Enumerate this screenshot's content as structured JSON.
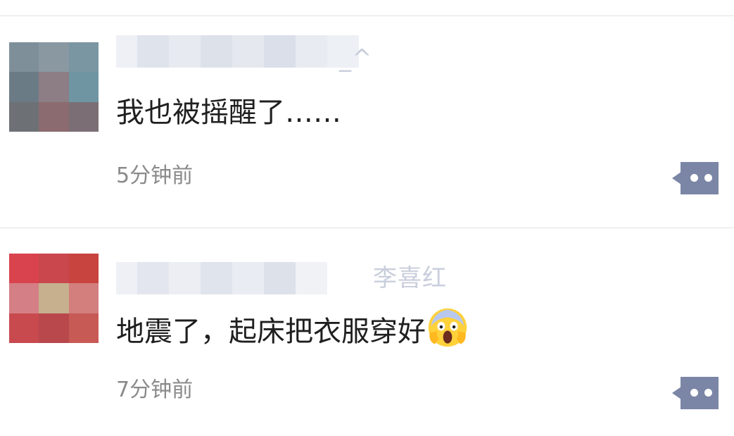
{
  "comments": [
    {
      "author_name_visible_suffix": "_^",
      "text": "我也被摇醒了……",
      "time": "5分钟前",
      "avatar_colors": [
        "#7e8f9a",
        "#8a98a2",
        "#7b96a3",
        "#6b7b86",
        "#8c7e84",
        "#6f95a3",
        "#6d7176",
        "#8b6b70",
        "#7b6f75"
      ],
      "more_icon": "more-dots-icon"
    },
    {
      "author_name_visible_suffix": "李喜红",
      "text": "地震了，起床把衣服穿好",
      "emoji": "face-screaming-in-fear-icon",
      "time": "7分钟前",
      "avatar_colors": [
        "#d9434d",
        "#c9474d",
        "#c8443f",
        "#d47f85",
        "#c6b08d",
        "#d27f7e",
        "#c84a4e",
        "#b9484d",
        "#c85a55"
      ],
      "more_icon": "more-dots-icon"
    }
  ],
  "colors": {
    "divider": "#e3e3e3",
    "comment_text": "#1f1f1f",
    "timestamp": "#8a8a8a",
    "more_button": "#7b86a6",
    "name_blur": "#c9cedc"
  }
}
